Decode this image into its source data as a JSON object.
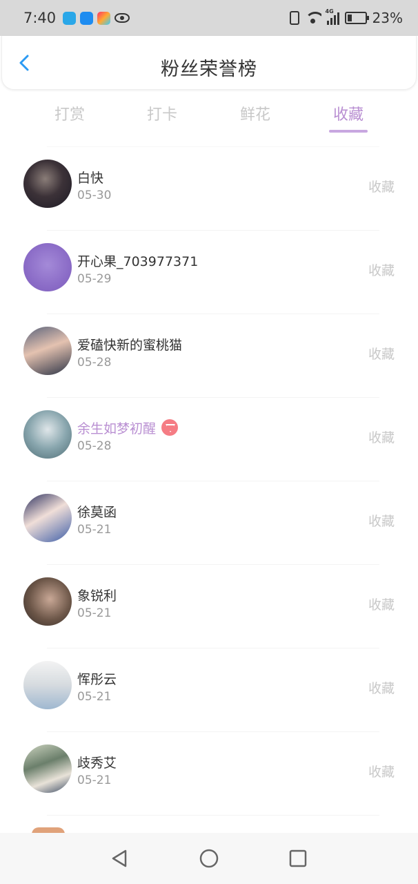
{
  "status_bar": {
    "time": "7:40",
    "battery": "23%",
    "network": "4G"
  },
  "header": {
    "title": "粉丝荣誉榜",
    "back_icon": "chevron-left-icon",
    "accent_color": "#2b9af3"
  },
  "tabs": [
    {
      "label": "打赏",
      "active": false
    },
    {
      "label": "打卡",
      "active": false
    },
    {
      "label": "鲜花",
      "active": false
    },
    {
      "label": "收藏",
      "active": true
    }
  ],
  "tab_active_color": "#b98fd2",
  "list": [
    {
      "name": "白快",
      "date": "05-30",
      "action": "收藏",
      "vip": false
    },
    {
      "name": "开心果_703977371",
      "date": "05-29",
      "action": "收藏",
      "vip": false
    },
    {
      "name": "爱磕快新的蜜桃猫",
      "date": "05-28",
      "action": "收藏",
      "vip": false
    },
    {
      "name": "余生如梦初醒",
      "date": "05-28",
      "action": "收藏",
      "vip": true
    },
    {
      "name": "徐莫函",
      "date": "05-21",
      "action": "收藏",
      "vip": false
    },
    {
      "name": "象锐利",
      "date": "05-21",
      "action": "收藏",
      "vip": false
    },
    {
      "name": "恽彤云",
      "date": "05-21",
      "action": "收藏",
      "vip": false
    },
    {
      "name": "歧秀艾",
      "date": "05-21",
      "action": "收藏",
      "vip": false
    }
  ],
  "nav": {
    "back": "triangle-back-icon",
    "home": "circle-home-icon",
    "recents": "square-recents-icon"
  }
}
